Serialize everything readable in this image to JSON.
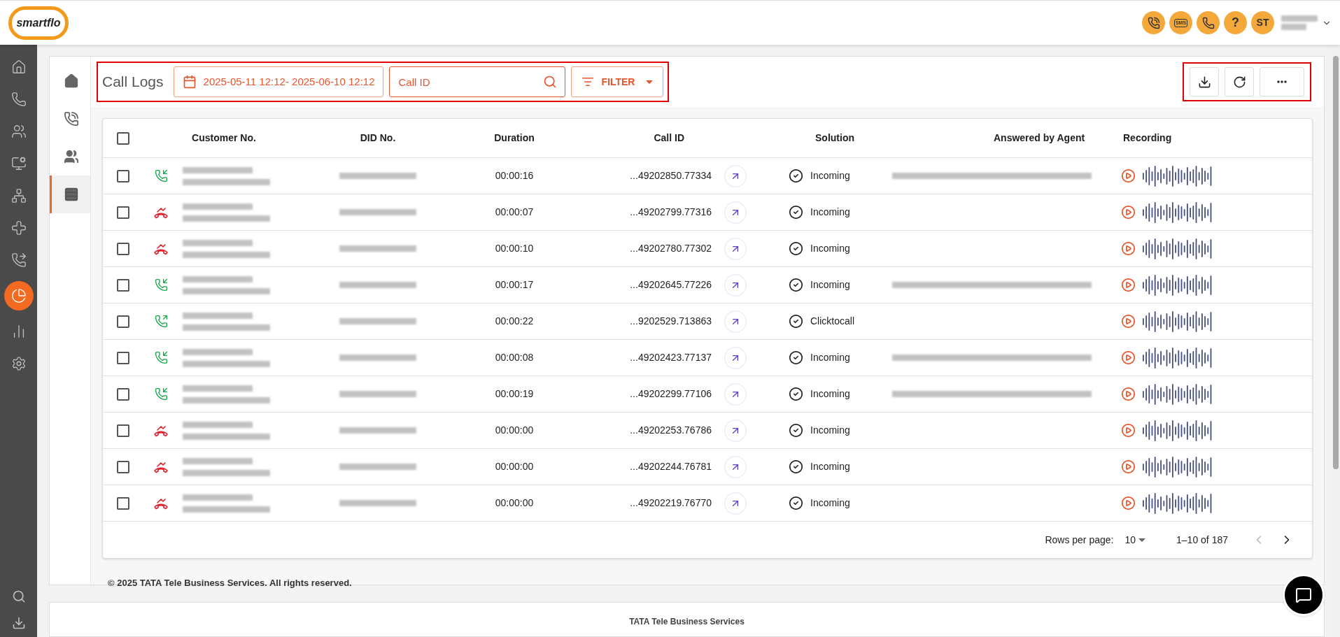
{
  "brand": {
    "logo_text": "smartflo"
  },
  "top_actions": {
    "sms_label": "SMS",
    "help_label": "?",
    "avatar_initials": "ST"
  },
  "nav_items": [
    {
      "selected": false
    },
    {
      "selected": false
    },
    {
      "selected": false
    },
    {
      "selected": false
    },
    {
      "selected": false
    },
    {
      "selected": false
    },
    {
      "selected": false
    },
    {
      "selected": true
    },
    {
      "selected": false
    },
    {
      "selected": false
    }
  ],
  "subnav_items": [
    {
      "selected": false
    },
    {
      "selected": false
    },
    {
      "selected": false
    },
    {
      "selected": true
    }
  ],
  "toolbar": {
    "title": "Call Logs",
    "date_range": "2025-05-11 12:12- 2025-06-10 12:12",
    "search": {
      "placeholder": "Call ID"
    },
    "filter_label": "FILTER"
  },
  "table": {
    "columns": [
      "Customer No.",
      "DID No.",
      "Duration",
      "Call ID",
      "Solution",
      "Answered by Agent",
      "Recording"
    ],
    "all_checked": false,
    "rows": [
      {
        "checked": false,
        "kind": "incoming",
        "duration": "00:00:16",
        "call_id": "...49202850.77334",
        "solution": "Incoming",
        "agent_shown": true
      },
      {
        "checked": false,
        "kind": "missed",
        "duration": "00:00:07",
        "call_id": "...49202799.77316",
        "solution": "Incoming",
        "agent_shown": false
      },
      {
        "checked": false,
        "kind": "missed",
        "duration": "00:00:10",
        "call_id": "...49202780.77302",
        "solution": "Incoming",
        "agent_shown": false
      },
      {
        "checked": false,
        "kind": "incoming",
        "duration": "00:00:17",
        "call_id": "...49202645.77226",
        "solution": "Incoming",
        "agent_shown": true
      },
      {
        "checked": false,
        "kind": "outgoing",
        "duration": "00:00:22",
        "call_id": "...9202529.713863",
        "solution": "Clicktocall",
        "agent_shown": false
      },
      {
        "checked": false,
        "kind": "incoming",
        "duration": "00:00:08",
        "call_id": "...49202423.77137",
        "solution": "Incoming",
        "agent_shown": true
      },
      {
        "checked": false,
        "kind": "incoming",
        "duration": "00:00:19",
        "call_id": "...49202299.77106",
        "solution": "Incoming",
        "agent_shown": true
      },
      {
        "checked": false,
        "kind": "missed",
        "duration": "00:00:00",
        "call_id": "...49202253.76786",
        "solution": "Incoming",
        "agent_shown": false
      },
      {
        "checked": false,
        "kind": "missed",
        "duration": "00:00:00",
        "call_id": "...49202244.76781",
        "solution": "Incoming",
        "agent_shown": false
      },
      {
        "checked": false,
        "kind": "missed",
        "duration": "00:00:00",
        "call_id": "...49202219.76770",
        "solution": "Incoming",
        "agent_shown": false
      }
    ]
  },
  "pagination": {
    "rows_per_page_label": "Rows per page:",
    "rows_per_page": "10",
    "range": "1–10 of 187"
  },
  "footer": {
    "copyright": "© 2025 TATA Tele Business Services. All rights reserved.",
    "company": "TATA Tele Business Services"
  }
}
